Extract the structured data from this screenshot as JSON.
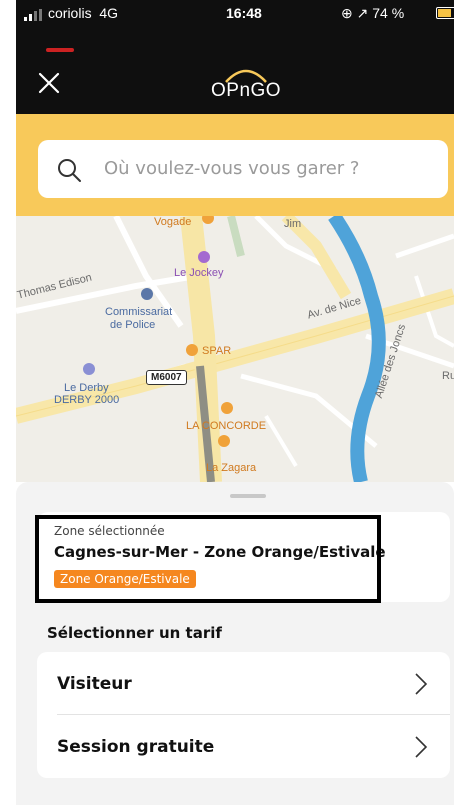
{
  "status_bar": {
    "carrier": "coriolis",
    "network": "4G",
    "time": "16:48",
    "right_text": "⊕ ↗ 74 %",
    "battery_percent": 74
  },
  "header": {
    "logo_text": "OPnGO",
    "close_icon": "close-icon"
  },
  "search": {
    "placeholder": "Où voulez-vous vous garer ?",
    "icon": "search-icon"
  },
  "map": {
    "labels": {
      "vogade": "Vogade",
      "le_jockey": "Le Jockey",
      "thomas_edison": "Thomas Edison",
      "commissariat": "Commissariat",
      "de_police": "de Police",
      "av_de_nice": "Av. de Nice",
      "spar": "SPAR",
      "m6007": "M6007",
      "le_derby": "Le Derby",
      "derby_2000": "DERBY 2000",
      "la_concorde": "LA CONCORDE",
      "la_zagara": "La Zagara",
      "allee_des_joncs": "Allée des Joncs",
      "ru": "Ru",
      "jim": "Jim"
    }
  },
  "sheet": {
    "zone_label": "Zone sélectionnée",
    "zone_name": "Cagnes-sur-Mer - Zone Orange/Estivale",
    "zone_badge": "Zone Orange/Estivale",
    "tarif_title": "Sélectionner un tarif",
    "tarifs": [
      {
        "label": "Visiteur"
      },
      {
        "label": "Session gratuite"
      }
    ]
  },
  "colors": {
    "header_bg": "#0f0f0f",
    "search_band": "#f8c95a",
    "zone_badge": "#f5871f",
    "river": "#4fa3d9"
  }
}
